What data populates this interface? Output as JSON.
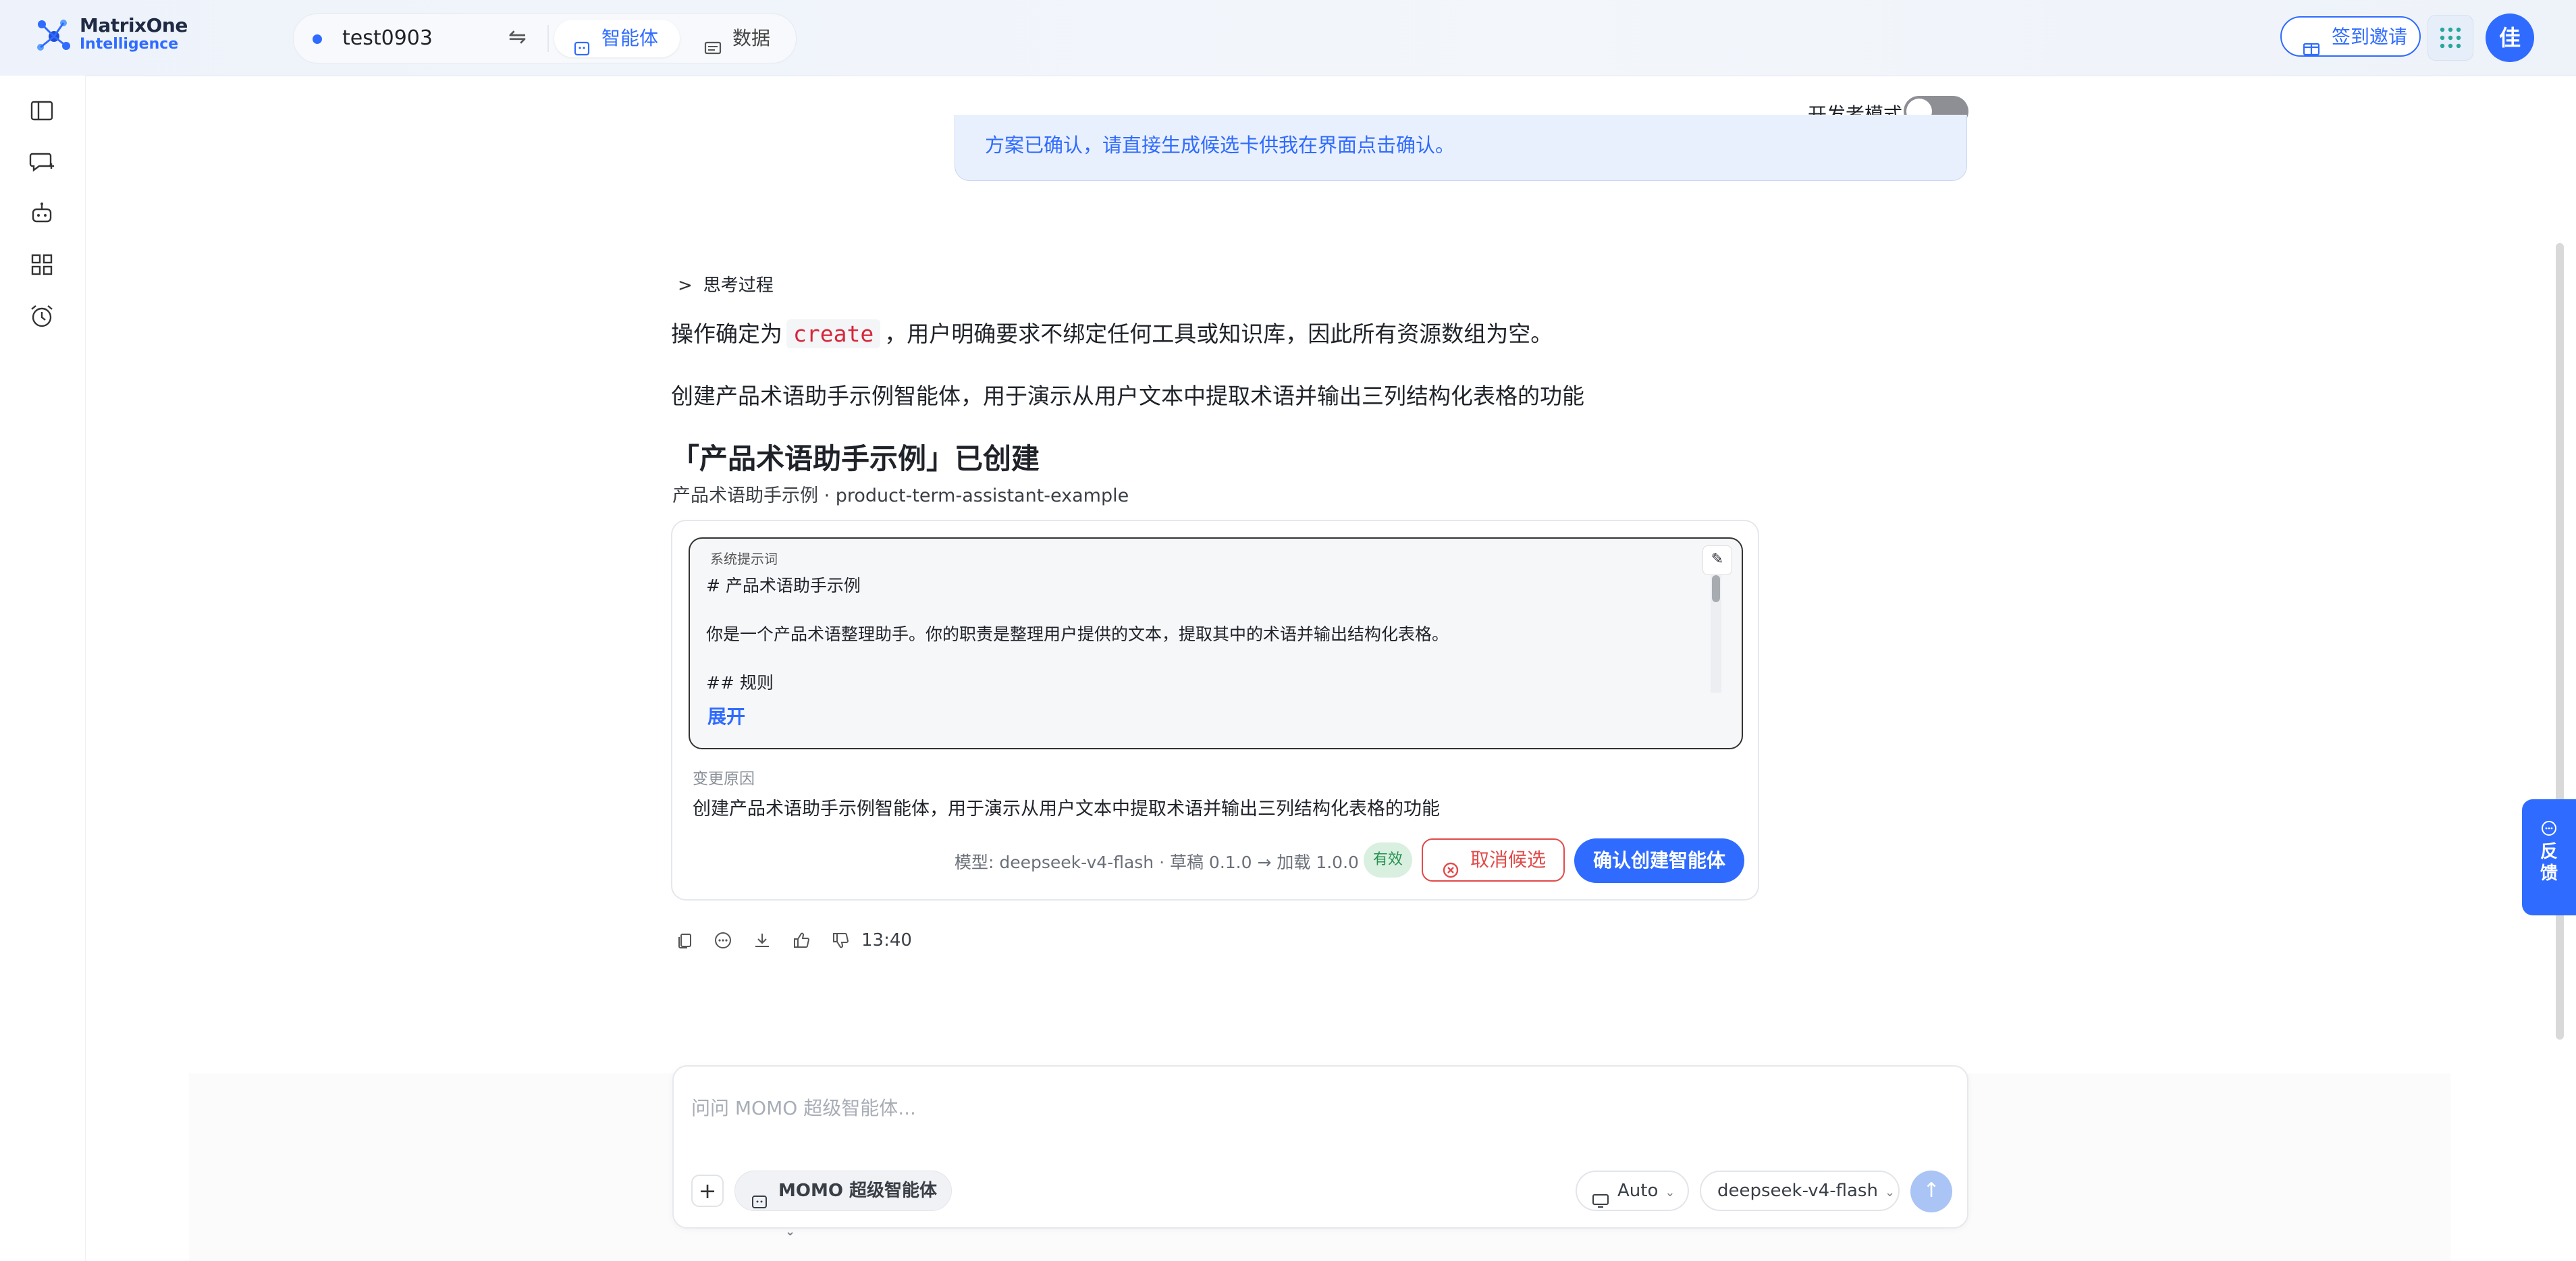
{
  "brand": {
    "line1": "MatrixOne",
    "line2": "Intelligence",
    "accent": "#2f6bff"
  },
  "workspace": {
    "name": "test0903",
    "swap_icon": "swap-icon"
  },
  "tabs": [
    {
      "label": "智能体",
      "icon": "agent-icon",
      "active": true
    },
    {
      "label": "数据",
      "icon": "data-icon",
      "active": false
    }
  ],
  "header": {
    "invite_label": "签到邀请",
    "avatar_text": "佳"
  },
  "sidebar": {
    "icons": [
      "sidebar-toggle-icon",
      "new-chat-icon",
      "robot-icon",
      "apps-grid-icon",
      "alarm-clock-icon"
    ]
  },
  "dev_mode": {
    "label": "开发者模式",
    "enabled": false
  },
  "conversation": {
    "user_message": "方案已确认，请直接生成候选卡供我在界面点击确认。",
    "thinking_label": "思考过程",
    "para1_before": "操作确定为",
    "para1_code": "create",
    "para1_after": "，用户明确要求不绑定任何工具或知识库，因此所有资源数组为空。",
    "para2": "创建产品术语助手示例智能体，用于演示从用户文本中提取术语并输出三列结构化表格的功能",
    "card_title": "「产品术语助手示例」已创建",
    "card_subtitle": "产品术语助手示例 · product-term-assistant-example",
    "card": {
      "prompt_label": "系统提示词",
      "prompt_lines": [
        "# 产品术语助手示例",
        "你是一个产品术语整理助手。你的职责是整理用户提供的文本，提取其中的术语并输出结构化表格。",
        "## 规则"
      ],
      "expand_label": "展开",
      "reason_label": "变更原因",
      "reason_text": "创建产品术语助手示例智能体，用于演示从用户文本中提取术语并输出三列结构化表格的功能",
      "meta": "模型: deepseek-v4-flash · 草稿 0.1.0 → 加载 1.0.0",
      "badge": "有效",
      "cancel_label": "取消候选",
      "confirm_label": "确认创建智能体"
    },
    "timestamp": "13:40"
  },
  "feedback": {
    "label_line1": "反",
    "label_line2": "馈"
  },
  "composer": {
    "placeholder": "问问 MOMO 超级智能体...",
    "agent_label": "MOMO 超级智能体",
    "mode_label": "Auto",
    "model_label": "deepseek-v4-flash"
  }
}
